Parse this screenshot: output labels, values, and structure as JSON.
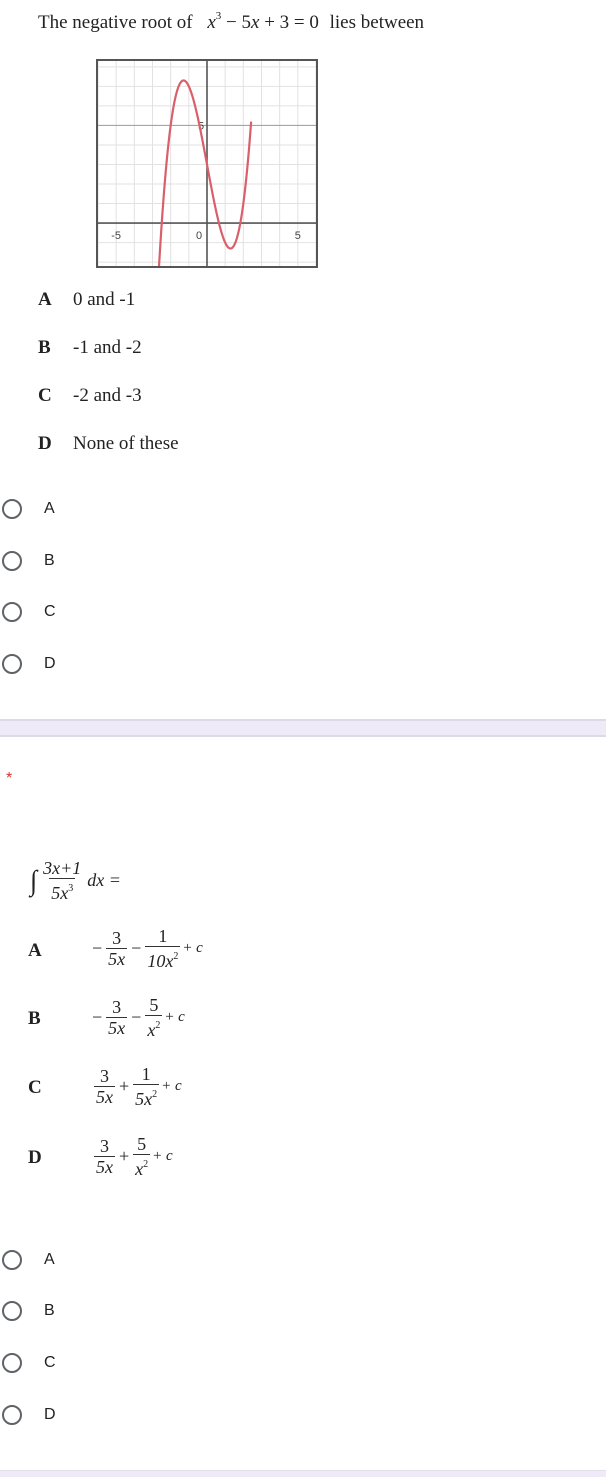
{
  "question1": {
    "prefix": "The negative root of",
    "equation": {
      "x": "x",
      "exp": "3",
      "rest_a": " − 5",
      "x2": "x",
      "rest_b": " + 3 = 0"
    },
    "suffix": "lies between",
    "graph": {
      "function": "x^3 - 5x + 3",
      "x_range": [
        -6,
        6
      ],
      "y_range": [
        -2.2,
        8.3
      ],
      "grid_step": 1,
      "tick_labels": {
        "x_neg": "-5",
        "origin": "0",
        "x_pos": "5",
        "y": "5"
      },
      "curve_color": "#d9606a",
      "axis_color": "#555555",
      "grid_color": "#e2e2e2"
    },
    "options": [
      {
        "letter": "A",
        "text": "0 and -1"
      },
      {
        "letter": "B",
        "text": "-1 and -2"
      },
      {
        "letter": "C",
        "text": "-2 and -3"
      },
      {
        "letter": "D",
        "text": "None of these"
      }
    ],
    "choices": [
      "A",
      "B",
      "C",
      "D"
    ]
  },
  "question2": {
    "required_marker": "*",
    "prompt": {
      "integral": "∫",
      "num": "3x+1",
      "den_base": "5x",
      "den_exp": "3",
      "tail": "dx ="
    },
    "options": [
      {
        "letter": "A",
        "lead": "−",
        "f1_num": "3",
        "f1_den": "5x",
        "op": "−",
        "f2_num": "1",
        "f2_den": "10x",
        "f2_exp": "2",
        "tail": "+ c"
      },
      {
        "letter": "B",
        "lead": "−",
        "f1_num": "3",
        "f1_den": "5x",
        "op": "−",
        "f2_num": "5",
        "f2_den": "x",
        "f2_exp": "2",
        "tail": "+ c"
      },
      {
        "letter": "C",
        "lead": "",
        "f1_num": "3",
        "f1_den": "5x",
        "op": "+",
        "f2_num": "1",
        "f2_den": "5x",
        "f2_exp": "2",
        "tail": "+ c"
      },
      {
        "letter": "D",
        "lead": "",
        "f1_num": "3",
        "f1_den": "5x",
        "op": "+",
        "f2_num": "5",
        "f2_den": "x",
        "f2_exp": "2",
        "tail": "+ c"
      }
    ],
    "choices": [
      "A",
      "B",
      "C",
      "D"
    ]
  },
  "colors": {
    "required": "#d93025",
    "separator": "#eeeaf8",
    "radio_border": "#5f6368"
  }
}
